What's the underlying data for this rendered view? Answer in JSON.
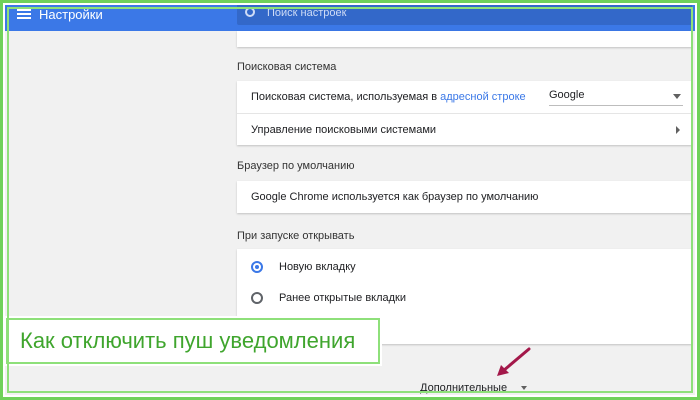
{
  "header": {
    "title": "Настройки",
    "search_placeholder": "Поиск настроек"
  },
  "sections": {
    "search_engine": {
      "title": "Поисковая система",
      "row1_text": "Поисковая система, используемая в",
      "row1_link": "адресной строке",
      "select_value": "Google",
      "row2_text": "Управление поисковыми системами"
    },
    "default_browser": {
      "title": "Браузер по умолчанию",
      "row_text": "Google Chrome используется как браузер по умолчанию"
    },
    "startup": {
      "title": "При запуске открывать",
      "options": [
        {
          "label": "Новую вкладку",
          "checked": true
        },
        {
          "label": "Ранее открытые вкладки",
          "checked": false
        }
      ]
    }
  },
  "advanced_label": "Дополнительные",
  "banner_text": "Как отключить пуш уведомления",
  "colors": {
    "accent": "#3b78e7",
    "frame": "#6fd15a",
    "banner_text": "#3fa52d",
    "arrow": "#a3184a"
  },
  "icons": [
    "menu-icon",
    "search-icon",
    "chevron-down-icon",
    "chevron-right-icon",
    "arrow-icon"
  ]
}
